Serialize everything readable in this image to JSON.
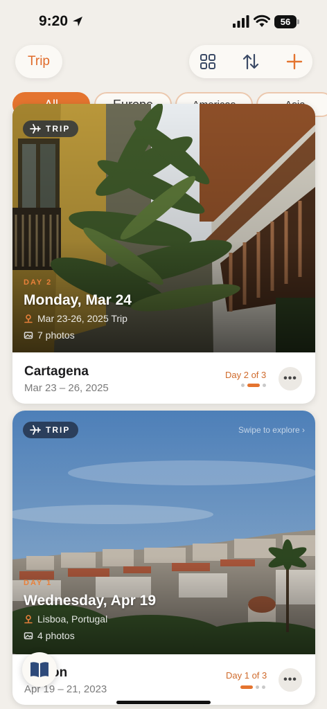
{
  "status_bar": {
    "time": "9:20",
    "battery_level": "56",
    "icons": [
      "location-arrow-icon",
      "signal-icon",
      "wifi-icon",
      "battery-icon"
    ]
  },
  "header": {
    "trip_label": "Trip",
    "actions": [
      "grid-view-icon",
      "sort-icon",
      "add-icon"
    ],
    "accent_color": "#e4742f"
  },
  "filters": {
    "chips": [
      "All",
      "Europe",
      "Americas",
      "Asia"
    ],
    "active": "All"
  },
  "cards": [
    {
      "badge": "TRIP",
      "day_label": "DAY 2",
      "title": "Monday, Mar 24",
      "trip_range": "Mar 23-26, 2025 Trip",
      "photos": "7 photos",
      "name": "Cartagena",
      "dates": "Mar 23 – 26, 2025",
      "day_counter": "Day 2 of 3",
      "active_dot": 2,
      "total_dots": 3
    },
    {
      "badge": "TRIP",
      "swipe_hint": "Swipe to explore",
      "day_label": "DAY 1",
      "title": "Wednesday, Apr 19",
      "location": "Lisboa, Portugal",
      "photos": "4 photos",
      "name": "Lisbon",
      "dates": "Apr 19 – 21, 2023",
      "day_counter": "Day 1 of 3",
      "active_dot": 1,
      "total_dots": 3
    }
  ],
  "fab": {
    "icon": "book-icon"
  }
}
